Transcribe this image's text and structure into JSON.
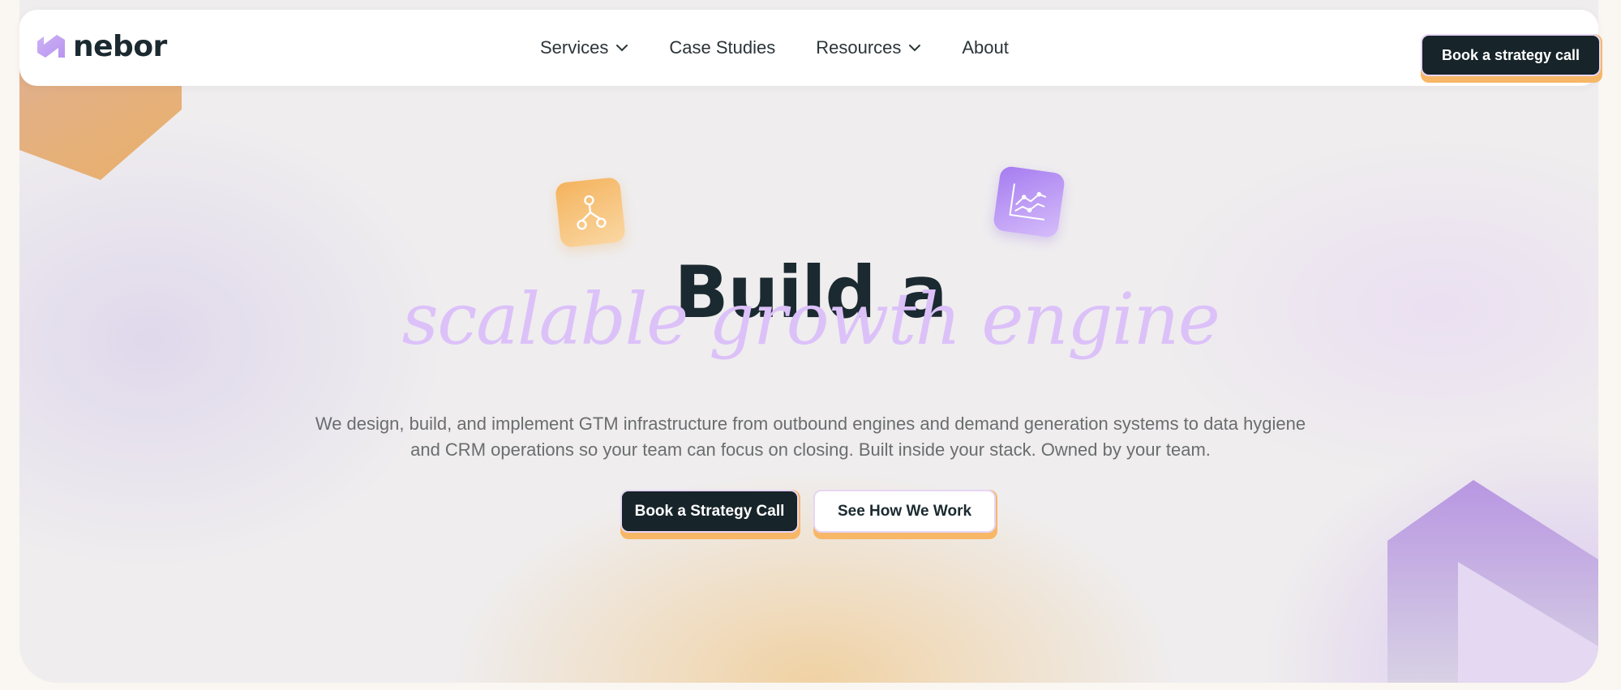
{
  "brand": {
    "name": "nebor"
  },
  "nav": {
    "items": [
      {
        "label": "Services",
        "has_dropdown": true
      },
      {
        "label": "Case Studies",
        "has_dropdown": false
      },
      {
        "label": "Resources",
        "has_dropdown": true
      },
      {
        "label": "About",
        "has_dropdown": false
      }
    ],
    "cta_label": "Book a strategy call"
  },
  "hero": {
    "headline": "Build a",
    "headline_italic": "scalable growth engine",
    "subtitle": "We design, build, and implement GTM infrastructure from outbound engines and demand generation systems to data hygiene and CRM operations so your team can focus on closing. Built inside your stack. Owned by your team.",
    "primary_cta": "Book a Strategy Call",
    "secondary_cta": "See How We Work",
    "icons": [
      "workflow-icon",
      "line-chart-icon"
    ]
  },
  "colors": {
    "dark": "#172429",
    "accent_orange": "#f7b766",
    "accent_lavender": "#dcc1f9",
    "accent_purple": "#a57cf0"
  }
}
